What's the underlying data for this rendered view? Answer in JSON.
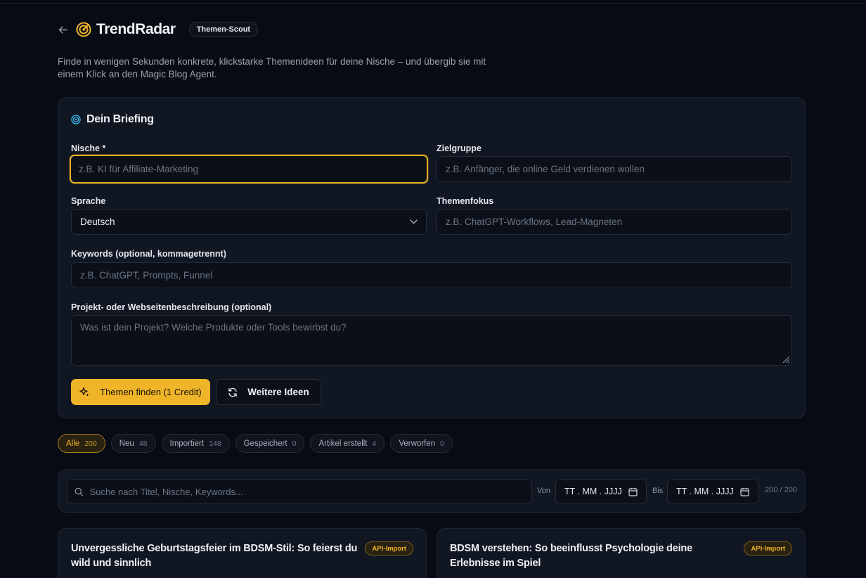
{
  "header": {
    "title": "TrendRadar",
    "badge": "Themen-Scout",
    "intro": "Finde in wenigen Sekunden konkrete, klickstarke Themenideen für deine Nische – und übergib sie mit einem Klick an den Magic Blog Agent."
  },
  "briefing": {
    "title": "Dein Briefing",
    "niche": {
      "label": "Nische *",
      "placeholder": "z.B. KI für Affiliate-Marketing"
    },
    "audience": {
      "label": "Zielgruppe",
      "placeholder": "z.B. Anfänger, die online Geld verdienen wollen"
    },
    "language": {
      "label": "Sprache",
      "value": "Deutsch"
    },
    "focus": {
      "label": "Themenfokus",
      "placeholder": "z.B. ChatGPT-Workflows, Lead-Magneten"
    },
    "keywords": {
      "label": "Keywords (optional, kommagetrennt)",
      "placeholder": "z.B. ChatGPT, Prompts, Funnel"
    },
    "description": {
      "label": "Projekt- oder Webseitenbeschreibung (optional)",
      "placeholder": "Was ist dein Projekt? Welche Produkte oder Tools bewirbst du?"
    },
    "find_button": "Themen finden (1 Credit)",
    "more_button": "Weitere Ideen"
  },
  "filters": [
    {
      "label": "Alle",
      "count": "200"
    },
    {
      "label": "Neu",
      "count": "48"
    },
    {
      "label": "Importiert",
      "count": "148"
    },
    {
      "label": "Gespeichert",
      "count": "0"
    },
    {
      "label": "Artikel erstellt",
      "count": "4"
    },
    {
      "label": "Verworfen",
      "count": "0"
    }
  ],
  "search": {
    "placeholder": "Suche nach Titel, Nische, Keywords...",
    "from_label": "Von",
    "to_label": "Bis",
    "date_placeholder": "TT . MM . JJJJ",
    "count": "200 / 200"
  },
  "results": [
    {
      "title": "Unvergessliche Geburtstagsfeier im BDSM-Stil: So feierst du wild und sinnlich",
      "badge": "API-Import"
    },
    {
      "title": "BDSM verstehen: So beeinflusst Psychologie deine Erlebnisse im Spiel",
      "badge": "API-Import"
    }
  ],
  "colors": {
    "accent": "#f0b429",
    "background": "#070b13",
    "card": "#111722"
  }
}
